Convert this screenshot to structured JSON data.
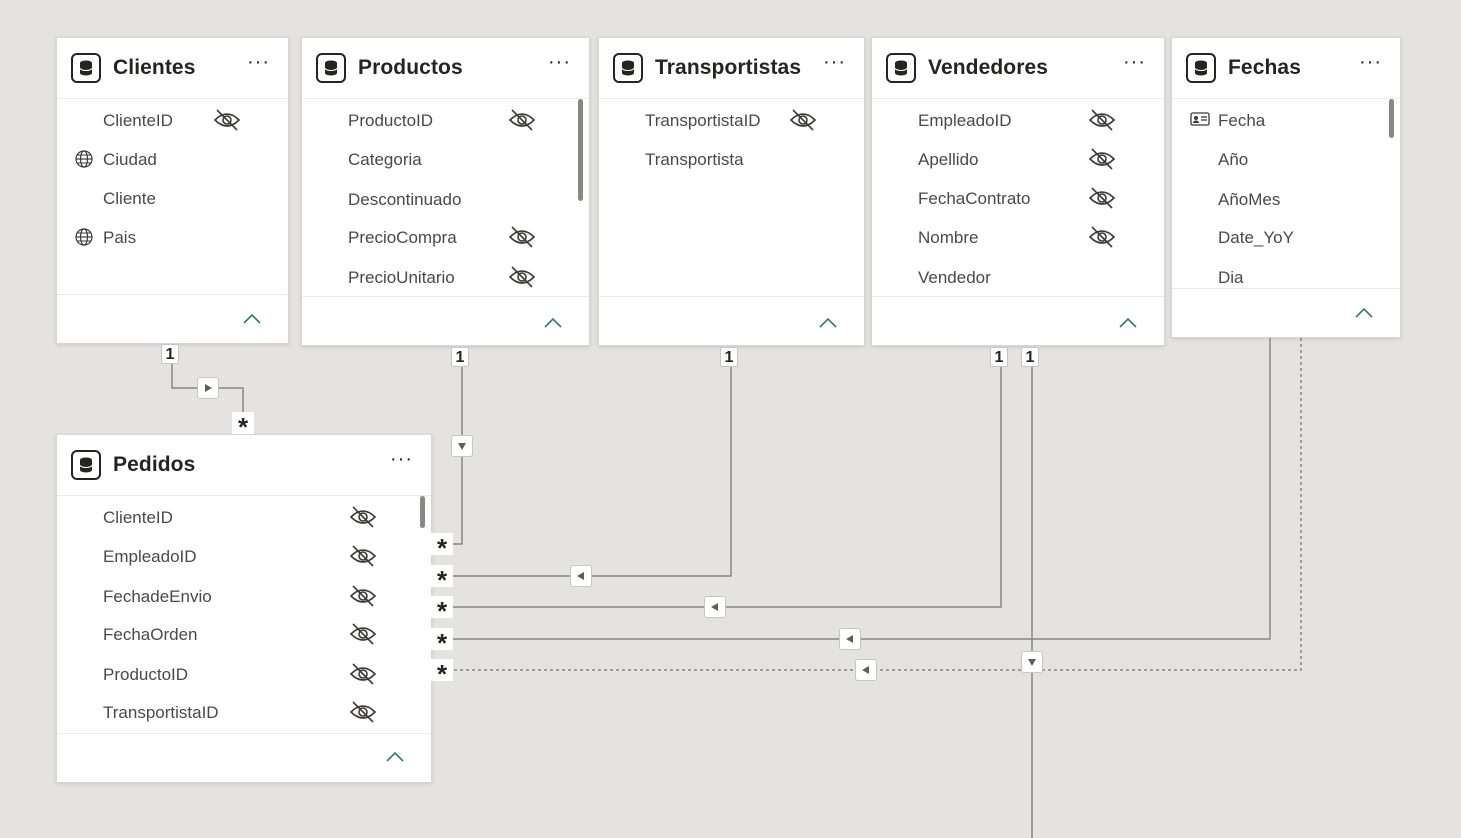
{
  "tables": {
    "clientes": {
      "name": "Clientes",
      "more": "···",
      "fields": [
        {
          "name": "ClienteID",
          "hidden": true,
          "type_icon": ""
        },
        {
          "name": "Ciudad",
          "hidden": false,
          "type_icon": "globe-icon"
        },
        {
          "name": "Cliente",
          "hidden": false,
          "type_icon": ""
        },
        {
          "name": "Pais",
          "hidden": false,
          "type_icon": "globe-icon"
        }
      ]
    },
    "productos": {
      "name": "Productos",
      "more": "···",
      "fields": [
        {
          "name": "ProductoID",
          "hidden": true
        },
        {
          "name": "Categoria",
          "hidden": false
        },
        {
          "name": "Descontinuado",
          "hidden": false
        },
        {
          "name": "PrecioCompra",
          "hidden": true
        },
        {
          "name": "PrecioUnitario",
          "hidden": true
        }
      ]
    },
    "transportistas": {
      "name": "Transportistas",
      "more": "···",
      "fields": [
        {
          "name": "TransportistaID",
          "hidden": true
        },
        {
          "name": "Transportista",
          "hidden": false
        }
      ]
    },
    "vendedores": {
      "name": "Vendedores",
      "more": "···",
      "fields": [
        {
          "name": "EmpleadoID",
          "hidden": true
        },
        {
          "name": "Apellido",
          "hidden": true
        },
        {
          "name": "FechaContrato",
          "hidden": true
        },
        {
          "name": "Nombre",
          "hidden": true
        },
        {
          "name": "Vendedor",
          "hidden": false
        }
      ]
    },
    "fechas": {
      "name": "Fechas",
      "more": "···",
      "fields": [
        {
          "name": "Fecha",
          "hidden": false,
          "type_icon": "id-card-icon"
        },
        {
          "name": "Año",
          "hidden": false
        },
        {
          "name": "AñoMes",
          "hidden": false
        },
        {
          "name": "Date_YoY",
          "hidden": false
        },
        {
          "name": "Dia",
          "hidden": false
        }
      ]
    },
    "pedidos": {
      "name": "Pedidos",
      "more": "···",
      "fields": [
        {
          "name": "ClienteID",
          "hidden": true
        },
        {
          "name": "EmpleadoID",
          "hidden": true
        },
        {
          "name": "FechadeEnvio",
          "hidden": true
        },
        {
          "name": "FechaOrden",
          "hidden": true
        },
        {
          "name": "ProductoID",
          "hidden": true
        },
        {
          "name": "TransportistaID",
          "hidden": true
        }
      ]
    }
  },
  "relationships": {
    "one": "1",
    "many": "*"
  },
  "colors": {
    "canvas": "#e4e3e2",
    "card": "#ffffff",
    "line": "#8a8886",
    "text": "#252423",
    "collapse": "#2e7d6e"
  }
}
